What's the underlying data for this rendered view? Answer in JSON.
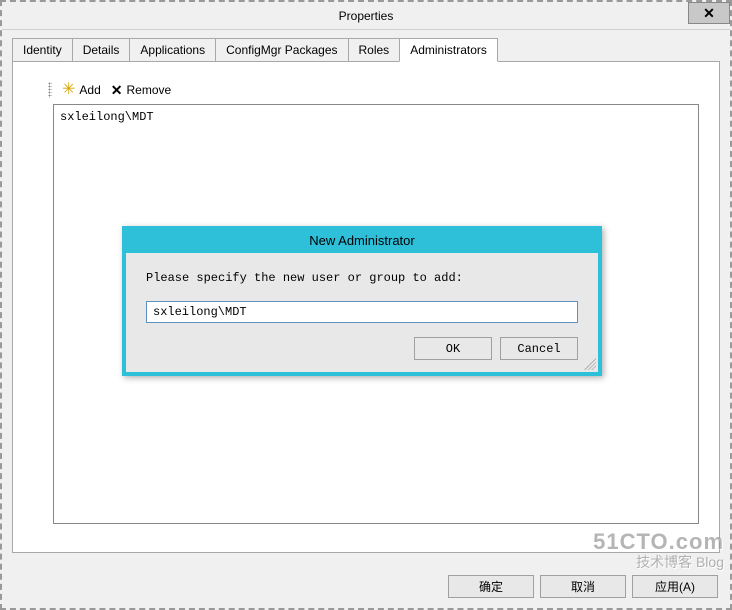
{
  "window": {
    "title": "Properties",
    "close_glyph": "✕"
  },
  "tabs": [
    {
      "label": "Identity"
    },
    {
      "label": "Details"
    },
    {
      "label": "Applications"
    },
    {
      "label": "ConfigMgr Packages"
    },
    {
      "label": "Roles"
    },
    {
      "label": "Administrators"
    }
  ],
  "toolbar": {
    "add_label": "Add",
    "remove_label": "Remove",
    "add_glyph": "✳",
    "remove_glyph": "✕"
  },
  "admin_list": {
    "items": [
      "sxleilong\\MDT"
    ]
  },
  "buttons": {
    "ok": "确定",
    "cancel": "取消",
    "apply": "应用(A)"
  },
  "modal": {
    "title": "New Administrator",
    "prompt": "Please specify the new user or group to add:",
    "value": "sxleilong\\MDT",
    "ok": "OK",
    "cancel": "Cancel"
  },
  "watermark": {
    "line1": "51CTO.com",
    "line2": "技术博客 Blog"
  }
}
